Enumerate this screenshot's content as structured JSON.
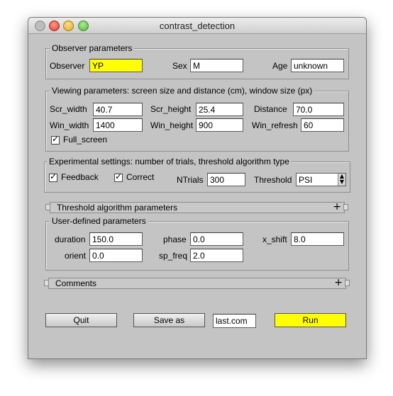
{
  "window": {
    "title": "contrast_detection"
  },
  "observer": {
    "legend": "Observer parameters",
    "observer_label": "Observer",
    "observer_value": "YP",
    "sex_label": "Sex",
    "sex_value": "M",
    "age_label": "Age",
    "age_value": "unknown"
  },
  "viewing": {
    "legend": "Viewing parameters: screen size and distance (cm), window size (px)",
    "scr_width_label": "Scr_width",
    "scr_width_value": "40.7",
    "scr_height_label": "Scr_height",
    "scr_height_value": "25.4",
    "distance_label": "Distance",
    "distance_value": "70.0",
    "win_width_label": "Win_width",
    "win_width_value": "1400",
    "win_height_label": "Win_height",
    "win_height_value": "900",
    "win_refresh_label": "Win_refresh",
    "win_refresh_value": "60",
    "full_screen_label": "Full_screen"
  },
  "experimental": {
    "legend": "Experimental settings: number of trials, threshold algorithm type",
    "feedback_label": "Feedback",
    "correct_label": "Correct",
    "ntrials_label": "NTrials",
    "ntrials_value": "300",
    "threshold_label": "Threshold",
    "threshold_value": "PSI"
  },
  "threshold_section": {
    "label": "Threshold algorithm parameters",
    "toggle": "+"
  },
  "user_defined": {
    "legend": "User-defined parameters",
    "duration_label": "duration",
    "duration_value": "150.0",
    "phase_label": "phase",
    "phase_value": "0.0",
    "x_shift_label": "x_shift",
    "x_shift_value": "8.0",
    "orient_label": "orient",
    "orient_value": "0.0",
    "sp_freq_label": "sp_freq",
    "sp_freq_value": "2.0"
  },
  "comments_section": {
    "label": "Comments",
    "toggle": "+"
  },
  "footer": {
    "quit_label": "Quit",
    "save_as_label": "Save as",
    "filename_value": "last.com",
    "run_label": "Run"
  },
  "colors": {
    "highlight": "#ffff00",
    "window_bg": "#c4c4c4"
  }
}
